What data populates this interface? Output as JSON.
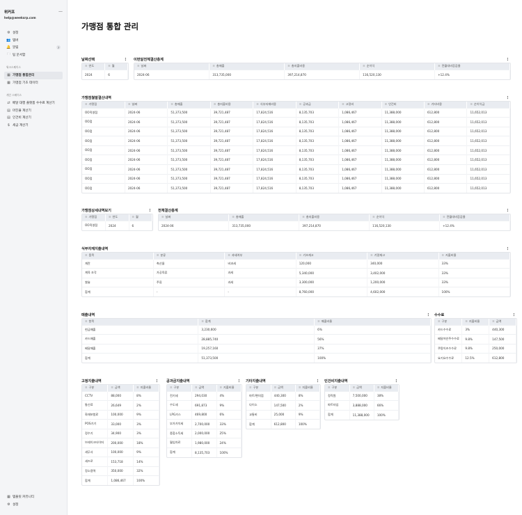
{
  "sidebar": {
    "brand": "위커프",
    "email": "help@weeksrp.com",
    "toggle_icon": "—",
    "top_items": [
      {
        "label": "설정",
        "icon": "gear"
      },
      {
        "label": "템버",
        "icon": "users"
      },
      {
        "label": "알림",
        "icon": "bell",
        "badge": "7"
      },
      {
        "label": "팀 문서함",
        "icon": "folder"
      }
    ],
    "section1_label": "워크스페이스",
    "section1_items": [
      {
        "label": "가맹점 통합관리",
        "icon": "table",
        "active": true
      },
      {
        "label": "가맹점 기초 데이터",
        "icon": "table"
      }
    ],
    "section2_label": "개인 스페이스",
    "section2_items": [
      {
        "label": "배달 대행 플랫폼 수수료 계산기",
        "icon": "exchange"
      },
      {
        "label": "마진율 계산기",
        "icon": "calc"
      },
      {
        "label": "인건비 계산기",
        "icon": "calc"
      },
      {
        "label": "세금 계산기",
        "icon": "dollar"
      }
    ],
    "bottom_items": [
      {
        "label": "템플릿 커뮤니티",
        "icon": "grid"
      },
      {
        "label": "설정",
        "icon": "gear"
      }
    ]
  },
  "page": {
    "title": "가맹점 통합 관리"
  },
  "date_select": {
    "title": "날짜선택",
    "headers": [
      "연도",
      "월"
    ],
    "rows": [
      [
        "2024",
        "6"
      ]
    ]
  },
  "monthly_total": {
    "title": "이번달전체결산총계",
    "headers": [
      "날짜",
      "총매출",
      "총지출비용",
      "순이익",
      "전월대비증감율"
    ],
    "rows": [
      [
        "2024-06",
        "313,735,000",
        "397,214,870",
        "116,520,130",
        "+12.4%"
      ]
    ]
  },
  "store_monthly": {
    "title": "가맹점월말결산내역",
    "headers": [
      "가맹점",
      "날짜",
      "총매출",
      "총지출비용",
      "식부자재비용",
      "공과금",
      "고정비",
      "인건비",
      "기타비용",
      "순이익금"
    ],
    "rows": [
      [
        "OO직영점",
        "2024-06",
        "51,373,500",
        "39,721,487",
        "17,824,516",
        "8,135,703",
        "1,086,467",
        "11,388,000",
        "612,800",
        "11,652,013"
      ],
      [
        "OO점",
        "2024-06",
        "51,373,500",
        "39,721,487",
        "17,824,516",
        "8,135,703",
        "1,086,467",
        "11,388,000",
        "612,800",
        "11,652,013"
      ],
      [
        "OO점",
        "2024-06",
        "51,373,500",
        "39,721,487",
        "17,824,516",
        "8,135,703",
        "1,086,467",
        "11,388,000",
        "612,800",
        "11,652,013"
      ],
      [
        "OO점",
        "2024-06",
        "51,373,500",
        "39,721,487",
        "17,824,516",
        "8,135,703",
        "1,086,467",
        "11,388,000",
        "612,800",
        "11,652,013"
      ],
      [
        "OO점",
        "2024-06",
        "51,373,500",
        "39,721,487",
        "17,824,516",
        "8,135,703",
        "1,086,467",
        "11,388,000",
        "612,800",
        "11,652,013"
      ],
      [
        "OO점",
        "2024-06",
        "51,373,500",
        "39,721,487",
        "17,824,516",
        "8,135,703",
        "1,086,467",
        "11,388,000",
        "612,800",
        "11,652,013"
      ],
      [
        "OO점",
        "2024-06",
        "51,373,500",
        "39,721,487",
        "17,824,516",
        "8,135,703",
        "1,086,467",
        "11,388,000",
        "612,800",
        "11,652,013"
      ],
      [
        "OO점",
        "2024-06",
        "51,373,500",
        "39,721,487",
        "17,824,516",
        "8,135,703",
        "1,086,467",
        "11,388,000",
        "612,800",
        "11,652,013"
      ],
      [
        "OO점",
        "2024-06",
        "51,373,500",
        "39,721,487",
        "17,824,516",
        "8,135,703",
        "1,086,467",
        "11,388,000",
        "612,800",
        "11,652,013"
      ]
    ]
  },
  "store_detail": {
    "title": "가맹점상세내역보기",
    "headers": [
      "가맹점",
      "연도",
      "월"
    ],
    "rows": [
      [
        "OO직영점",
        "2024",
        "6"
      ]
    ]
  },
  "total_settlement": {
    "title": "전체결산총계",
    "headers": [
      "날짜",
      "총매출",
      "총지출비용",
      "순이익",
      "전월대비증감율"
    ],
    "rows": [
      [
        "2024-06",
        "313,735,000",
        "397,214,870",
        "116,520,130",
        "+12.4%"
      ]
    ]
  },
  "food_expense": {
    "title": "식부자재지출내역",
    "headers": [
      "품목",
      "분류",
      "과세여부",
      "기초재고",
      "기말재고",
      "지출비율"
    ],
    "rows": [
      [
        "계란",
        "축산물",
        "비과세",
        "120,000",
        "340,000",
        "33%"
      ],
      [
        "계육 조각",
        "가공육류",
        "과세",
        "5,340,000",
        "3,402,000",
        "33%"
      ],
      [
        "쌀술",
        "주류",
        "과세",
        "3,300,000",
        "1,200,000",
        "33%"
      ],
      [
        "합계",
        "-",
        "-",
        "8,760,000",
        "4,602,000",
        "100%"
      ]
    ]
  },
  "sales": {
    "title": "매출내역",
    "headers": [
      "항목",
      "합계",
      "매출비율"
    ],
    "rows": [
      [
        "현금매출",
        "3,230,600",
        "6%"
      ],
      [
        "카드매출",
        "28,885,740",
        "56%"
      ],
      [
        "배달매출",
        "19,257,160",
        "37%"
      ],
      [
        "합계",
        "51,373,500",
        "100%"
      ]
    ]
  },
  "fees": {
    "title": "수수료",
    "headers": [
      "구분",
      "지출비율",
      "금액"
    ],
    "rows": [
      [
        "카드수수료",
        "3%",
        "440,300"
      ],
      [
        "배달어인주수수료",
        "9.8%",
        "147,500"
      ],
      [
        "쿠팡이츠수수료",
        "9.8%",
        "250,000"
      ],
      [
        "요기요수수료",
        "12.5%",
        "612,800"
      ]
    ]
  },
  "fixed_expense": {
    "title": "고정지출내역",
    "headers": [
      "구분",
      "금액",
      "지출비율"
    ],
    "rows": [
      [
        "CCTV",
        "88,000",
        "8%"
      ],
      [
        "통신료",
        "26,649",
        "2%"
      ],
      [
        "화재보험료",
        "100,000",
        "9%"
      ],
      [
        "POS기기",
        "33,000",
        "3%"
      ],
      [
        "정수기",
        "34,900",
        "3%"
      ],
      [
        "브레이크타이머",
        "200,000",
        "18%"
      ],
      [
        "세무사",
        "100,000",
        "9%"
      ],
      [
        "세즈로",
        "153,718",
        "14%"
      ],
      [
        "정소용역",
        "350,000",
        "32%"
      ],
      [
        "합계",
        "1,086,467",
        "100%"
      ]
    ]
  },
  "utilities": {
    "title": "공과금지출내역",
    "headers": [
      "구분",
      "금액",
      "지출비율"
    ],
    "rows": [
      [
        "전기세",
        "294,030",
        "4%"
      ],
      [
        "수도세",
        "691,873",
        "9%"
      ],
      [
        "LPG가스",
        "469,800",
        "6%"
      ],
      [
        "부가가치세",
        "2,700,000",
        "33%"
      ],
      [
        "종합소득세",
        "2,000,000",
        "25%"
      ],
      [
        "월임차료",
        "1,980,000",
        "24%"
      ],
      [
        "합계",
        "8,135,703",
        "100%"
      ]
    ]
  },
  "other_expense": {
    "title": "기타지출내역",
    "headers": [
      "구분",
      "금액",
      "지출비율"
    ],
    "rows": [
      [
        "마트/편의점",
        "440,300",
        "8%"
      ],
      [
        "다이소",
        "147,500",
        "2%"
      ],
      [
        "교통비",
        "25,000",
        "9%"
      ],
      [
        "합계",
        "612,800",
        "100%"
      ]
    ]
  },
  "labor_expense": {
    "title": "인건비지출내역",
    "headers": [
      "구분",
      "금액",
      "지출비율"
    ],
    "rows": [
      [
        "정직원",
        "7,500,000",
        "38%"
      ],
      [
        "파트타임",
        "3,888,000",
        "66%"
      ],
      [
        "합계",
        "11,388,000",
        "100%"
      ]
    ]
  }
}
